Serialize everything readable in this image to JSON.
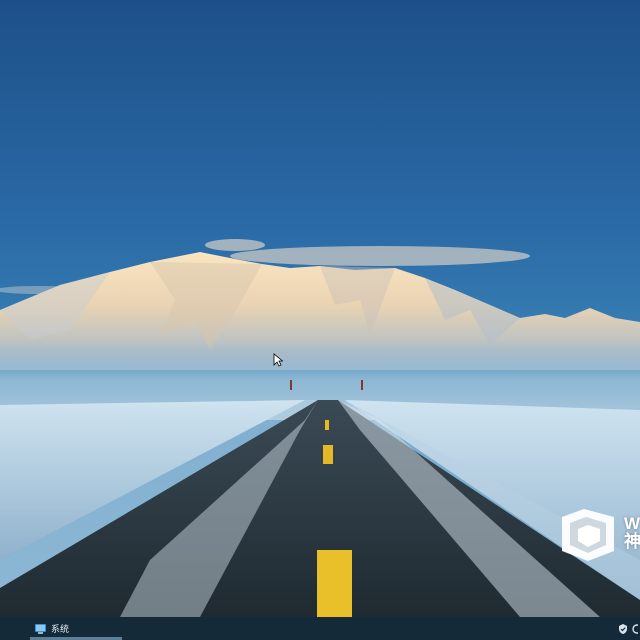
{
  "taskbar": {
    "pinned_item_label": "系统"
  },
  "watermark": {
    "line1": "W",
    "line2": "神"
  },
  "icons": {
    "taskbar_item": "system-app-icon",
    "tray_1": "shield-check-icon",
    "tray_2": "network-icon",
    "watermark_logo": "cube-logo-icon",
    "pointer": "mouse-cursor-icon"
  }
}
